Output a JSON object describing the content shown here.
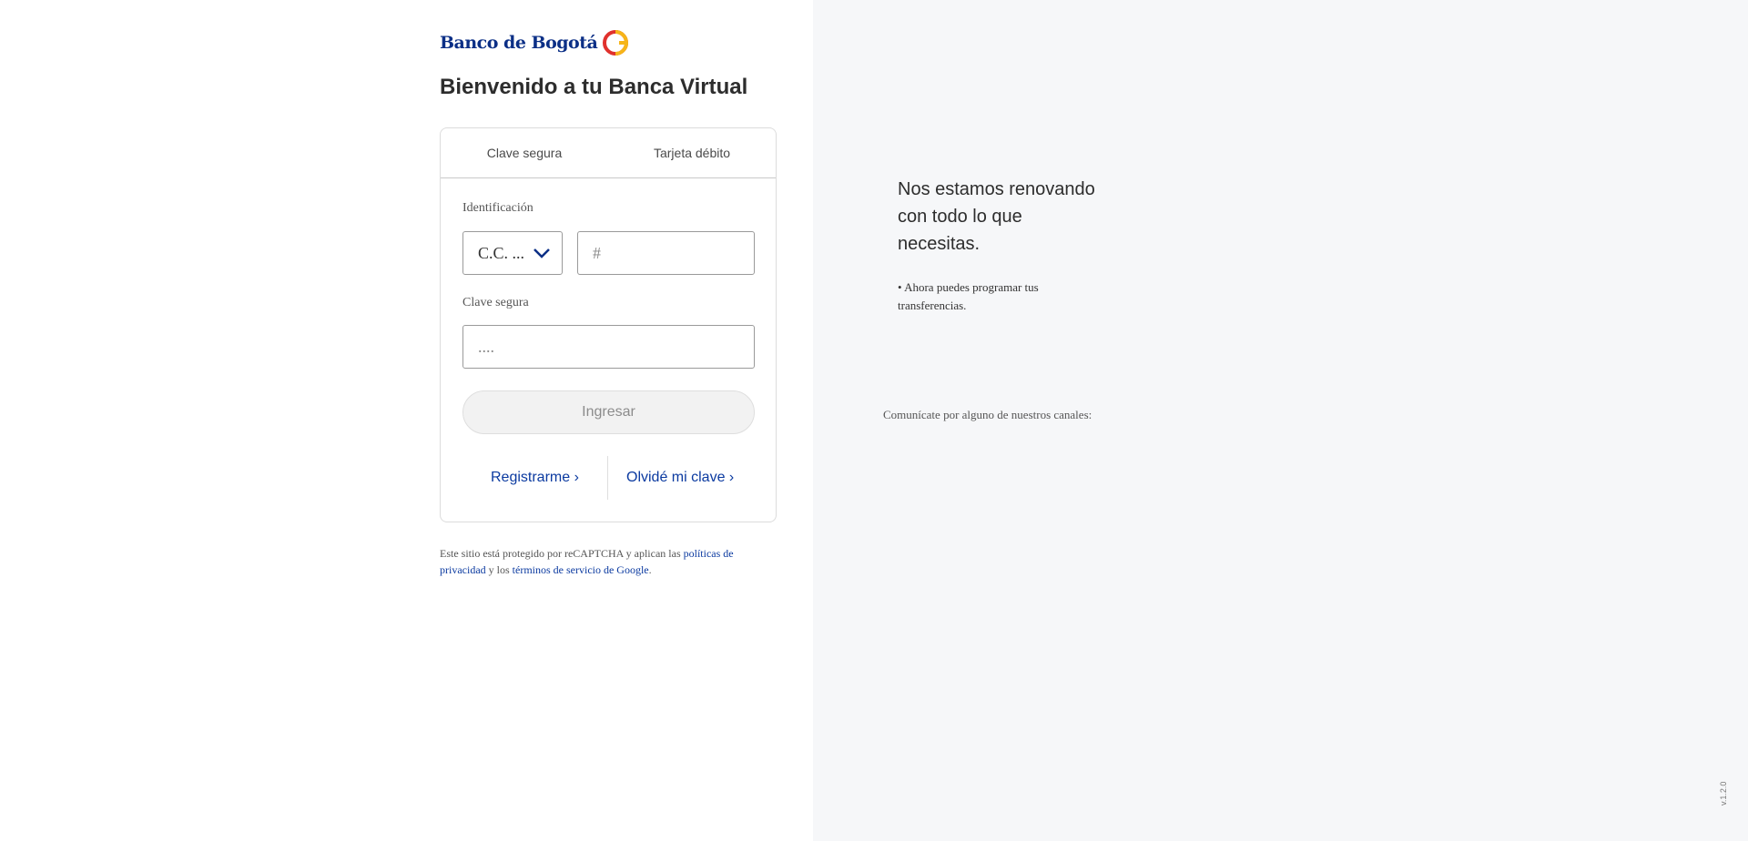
{
  "brand": {
    "name": "Banco de Bogotá",
    "colors": {
      "primary": "#0b2f86",
      "link": "#0b3aa0",
      "accent_red": "#e0312d",
      "accent_yellow": "#f6b519"
    }
  },
  "welcome_title": "Bienvenido a tu Banca Virtual",
  "tabs": [
    {
      "label": "Clave segura"
    },
    {
      "label": "Tarjeta débito"
    }
  ],
  "form": {
    "id_label": "Identificación",
    "id_type_value": "C.C. ...",
    "id_number_placeholder": "#",
    "password_label": "Clave segura",
    "password_placeholder": "....",
    "submit_label": "Ingresar"
  },
  "links": {
    "register": "Registrarme ›",
    "forgot": "Olvidé mi clave ›"
  },
  "legal": {
    "prefix": "Este sitio está protegido por reCAPTCHA y aplican las ",
    "privacy_link": "políticas de privacidad",
    "middle": " y los ",
    "terms_link": "términos de servicio de Google",
    "suffix": "."
  },
  "promo": {
    "title": "Nos estamos renovando con todo lo que necesitas.",
    "bullet": "• Ahora puedes programar tus transferencias."
  },
  "contact_text": "Comunícate por alguno de nuestros canales:",
  "version": "v.1.2.0"
}
